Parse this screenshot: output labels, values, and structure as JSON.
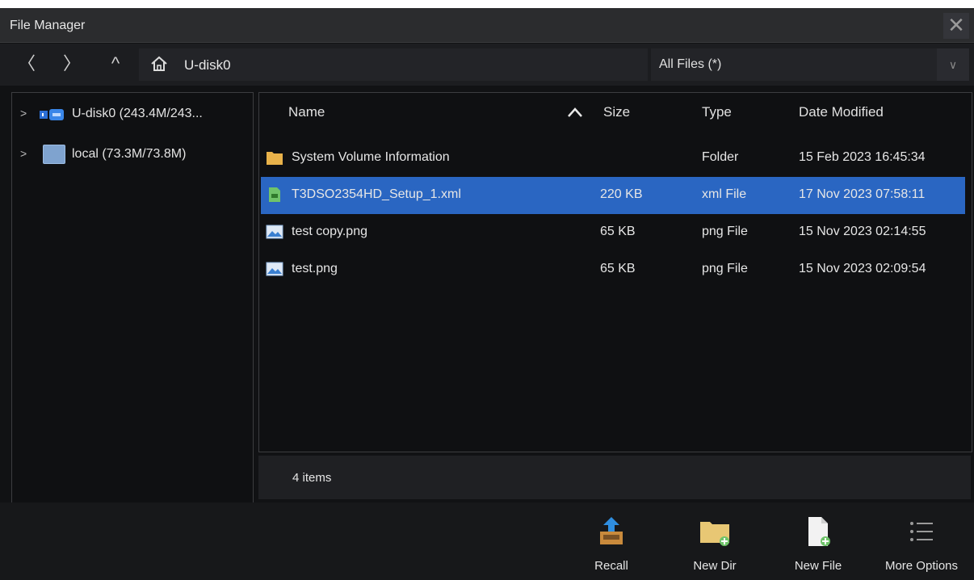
{
  "window": {
    "title": "File Manager",
    "close_glyph": "✕"
  },
  "navbar": {
    "back_glyph": "〈",
    "forward_glyph": "〉",
    "up_glyph": "^",
    "path": "U-disk0",
    "filter": "All Files (*)",
    "filter_arrow_glyph": "∨"
  },
  "tree": {
    "items": [
      {
        "label": "U-disk0  (243.4M/243...",
        "icon": "usb-drive-icon"
      },
      {
        "label": "local  (73.3M/73.8M)",
        "icon": "local-drive-icon"
      }
    ]
  },
  "list": {
    "headers": {
      "name": "Name",
      "size": "Size",
      "type": "Type",
      "date": "Date Modified"
    },
    "rows": [
      {
        "name": "System Volume Information",
        "size": "",
        "type": "Folder",
        "date": "15 Feb 2023 16:45:34",
        "icon": "folder-icon"
      },
      {
        "name": "T3DSO2354HD_Setup_1.xml",
        "size": "220 KB",
        "type": "xml File",
        "date": "17 Nov 2023 07:58:11",
        "icon": "xml-file-icon",
        "selected": true
      },
      {
        "name": "test copy.png",
        "size": "65 KB",
        "type": "png File",
        "date": "15 Nov 2023 02:14:55",
        "icon": "image-file-icon"
      },
      {
        "name": "test.png",
        "size": "65 KB",
        "type": "png File",
        "date": "15 Nov 2023 02:09:54",
        "icon": "image-file-icon"
      }
    ]
  },
  "status": {
    "text": "4 items"
  },
  "toolbar": {
    "recall": "Recall",
    "new_dir": "New Dir",
    "new_file": "New File",
    "more_options": "More Options"
  },
  "colors": {
    "selection": "#2a66c2",
    "background": "#111214",
    "folder": "#e8b24a"
  }
}
